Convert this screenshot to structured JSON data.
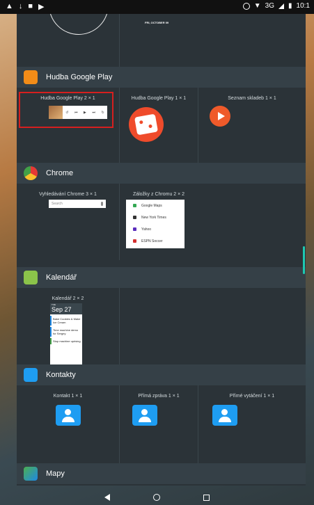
{
  "status": {
    "right_text": "3G",
    "time": "10:1"
  },
  "top": {
    "date_label": "FRI, OCTOBER 09"
  },
  "sections": [
    {
      "title": "Hudba Google Play",
      "icon": "google-play-music-icon",
      "widgets": [
        "Hudba Google Play 2 × 1",
        "Hudba Google Play 1 × 1",
        "Seznam skladeb 1 × 1"
      ]
    },
    {
      "title": "Chrome",
      "icon": "chrome-icon",
      "widgets": [
        "Vyhledávání Chrome 3 × 1",
        "Záložky z Chromu 2 × 2"
      ],
      "search_placeholder": "Search",
      "bookmarks": [
        "Google Maps",
        "New York Times",
        "Yahoo",
        "ESPN Soccer"
      ]
    },
    {
      "title": "Kalendář",
      "icon": "calendar-icon",
      "widgets": [
        "Kalendář 2 × 2"
      ],
      "calendar": {
        "day": "TUE",
        "date": "Sep 27",
        "events": [
          "Bake Cookies & Make Ice Cream",
          "Time machine demo for Sergey",
          "Stop machine uprising"
        ]
      }
    },
    {
      "title": "Kontakty",
      "icon": "contacts-icon",
      "widgets": [
        "Kontakt 1 × 1",
        "Přímá zpráva 1 × 1",
        "Přímé vytáčení 1 × 1"
      ]
    },
    {
      "title": "Mapy",
      "icon": "maps-icon",
      "widgets": []
    }
  ],
  "colors": {
    "accent": "#ef4b2b",
    "contacts": "#1e9df2",
    "highlight": "#d61f1f"
  }
}
